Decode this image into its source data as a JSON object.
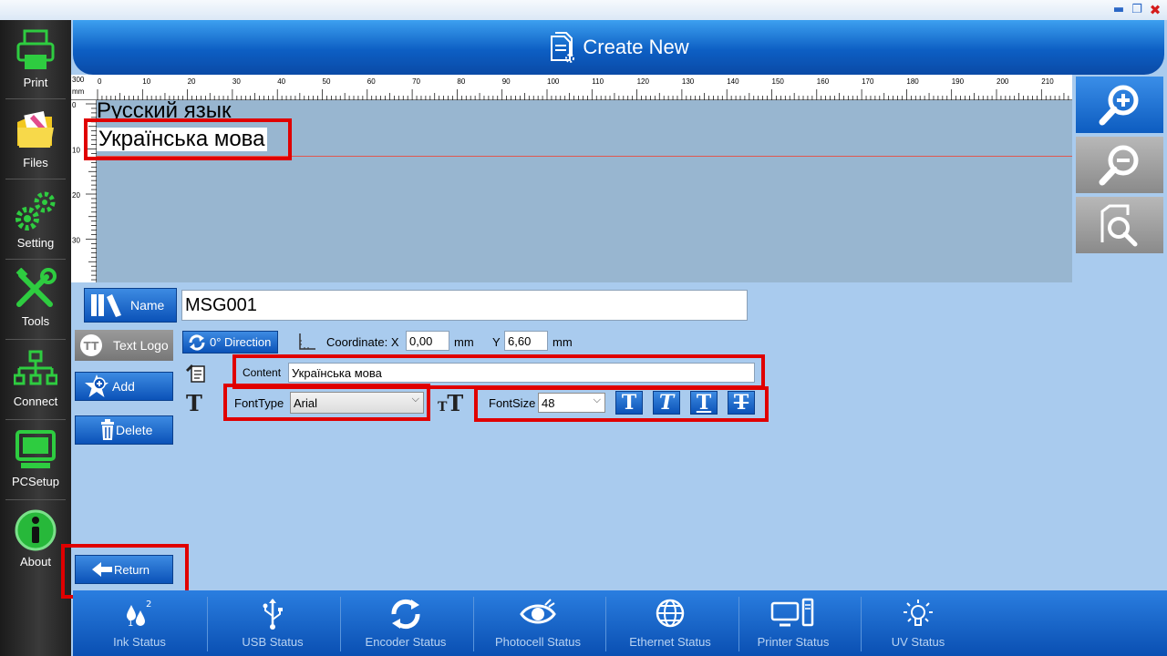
{
  "header": {
    "title": "Create New"
  },
  "sidebar": {
    "items": [
      {
        "label": "Print"
      },
      {
        "label": "Files"
      },
      {
        "label": "Setting"
      },
      {
        "label": "Tools"
      },
      {
        "label": "Connect"
      },
      {
        "label": "PCSetup"
      },
      {
        "label": "About"
      }
    ]
  },
  "ruler": {
    "corner_value": "300",
    "corner_unit": "mm",
    "top_labels": [
      "0",
      "10",
      "20",
      "30",
      "40",
      "50",
      "60",
      "70",
      "80",
      "90",
      "100",
      "110",
      "120",
      "130",
      "140",
      "150",
      "160",
      "170",
      "180",
      "190",
      "200",
      "210"
    ],
    "left_labels": [
      "0",
      "10",
      "20",
      "30"
    ]
  },
  "canvas": {
    "lines": [
      "Русский язык",
      "Українська мова"
    ]
  },
  "form": {
    "name_button": "Name",
    "name_value": "MSG001",
    "textlogo_button": "Text Logo",
    "direction_button": "0° Direction",
    "coordinate_label": "Coordinate: X",
    "x_value": "0,00",
    "x_unit": "mm",
    "y_label": "Y",
    "y_value": "6,60",
    "y_unit": "mm",
    "content_label": "Content",
    "content_value": "Українська мова",
    "fonttype_label": "FontType",
    "fonttype_value": "Arial",
    "fontsize_label": "FontSize",
    "fontsize_value": "48",
    "add_button": "Add",
    "delete_button": "Delete",
    "return_button": "Return"
  },
  "status": {
    "items": [
      {
        "label": "Ink Status"
      },
      {
        "label": "USB Status"
      },
      {
        "label": "Encoder Status"
      },
      {
        "label": "Photocell Status"
      },
      {
        "label": "Ethernet Status"
      },
      {
        "label": "Printer Status"
      },
      {
        "label": "UV Status"
      }
    ]
  },
  "colors": {
    "accent": "#0d5fc4",
    "highlight": "#e00000",
    "nav_icon": "#2ecc40"
  },
  "icons": [
    "minimize-icon",
    "restore-icon",
    "close-icon",
    "printer-icon",
    "files-icon",
    "gears-icon",
    "tools-icon",
    "network-icon",
    "monitor-icon",
    "info-icon",
    "zoom-in-icon",
    "zoom-out-icon",
    "zoom-fit-icon",
    "name-icon",
    "text-logo-icon",
    "rotate-icon",
    "coordinate-icon",
    "content-icon",
    "font-type-icon",
    "font-size-icon",
    "bold-icon",
    "italic-icon",
    "underline-icon",
    "strikethrough-icon",
    "add-icon",
    "delete-icon",
    "return-icon",
    "ink-icon",
    "usb-icon",
    "encoder-icon",
    "photocell-icon",
    "ethernet-icon",
    "printer-status-icon",
    "uv-icon",
    "create-doc-icon"
  ]
}
